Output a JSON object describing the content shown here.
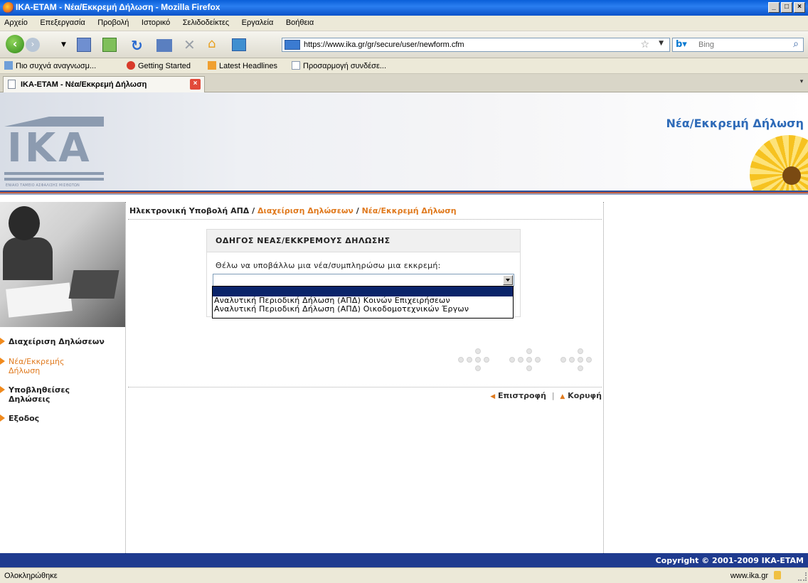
{
  "window": {
    "title": "ΙΚΑ-ΕΤΑΜ - Νέα/Εκκρεμή Δήλωση - Mozilla Firefox",
    "controls": [
      "_",
      "□",
      "×"
    ]
  },
  "menubar": {
    "items": [
      "Αρχείο",
      "Επεξεργασία",
      "Προβολή",
      "Ιστορικό",
      "Σελιδοδείκτες",
      "Εργαλεία",
      "Βοήθεια"
    ]
  },
  "navbar": {
    "url": "https://www.ika.gr/gr/secure/user/newform.cfm",
    "search_placeholder": "Bing"
  },
  "bookmarks": {
    "items": [
      "Πιο συχνά αναγνωσμ...",
      "Getting Started",
      "Latest Headlines",
      "Προσαρμογή συνδέσε..."
    ]
  },
  "tabs": {
    "active_label": "ΙΚΑ-ΕΤΑΜ - Νέα/Εκκρεμή Δήλωση"
  },
  "header": {
    "logo_text": "ΙΚΑ",
    "logo_subtitle": "ΕΝΙΑΙΟ ΤΑΜΕΙΟ ΑΣΦΑΛΙΣΗΣ ΜΙΣΘΩΤΩΝ",
    "page_title": "Νέα/Εκκρεμή Δήλωση"
  },
  "sidebar": {
    "items": [
      {
        "label": "Διαχείριση Δηλώσεων"
      },
      {
        "label": "Νέα/Εκκρεμής Δήλωση"
      },
      {
        "label": "Υποβληθείσες Δηλώσεις"
      },
      {
        "label": "Εξοδος"
      }
    ]
  },
  "breadcrumb": {
    "root": "Ηλεκτρονική Υποβολή ΑΠΔ",
    "sep": " / ",
    "level1": "Διαχείριση Δηλώσεων",
    "level2": "Νέα/Εκκρεμή Δήλωση"
  },
  "wizard": {
    "title": "ΟΔΗΓΟΣ ΝΕΑΣ/ΕΚΚΡΕΜΟΥΣ ΔΗΛΩΣΗΣ",
    "question": "Θέλω να υποβάλλω μια νέα/συμπληρώσω μια εκκρεμή:",
    "options": [
      "",
      "Αναλυτική Περιοδική Δήλωση (ΑΠΔ) Κοινών Επιχειρήσεων",
      "Αναλυτική Περιοδική Δήλωση (ΑΠΔ) Οικοδομοτεχνικών Έργων"
    ]
  },
  "bottomnav": {
    "back": "Επιστροφή",
    "sep": "|",
    "top": "Κορυφή"
  },
  "footer": {
    "copyright": "Copyright © 2001-2009 IKA-ETAM"
  },
  "statusbar": {
    "status": "Ολοκληρώθηκε",
    "host": "www.ika.gr"
  },
  "colors": {
    "accent_orange": "#e07a1e",
    "title_blue": "#2f6bb8",
    "footer_blue": "#1f3b8f",
    "select_highlight": "#0a246a"
  }
}
